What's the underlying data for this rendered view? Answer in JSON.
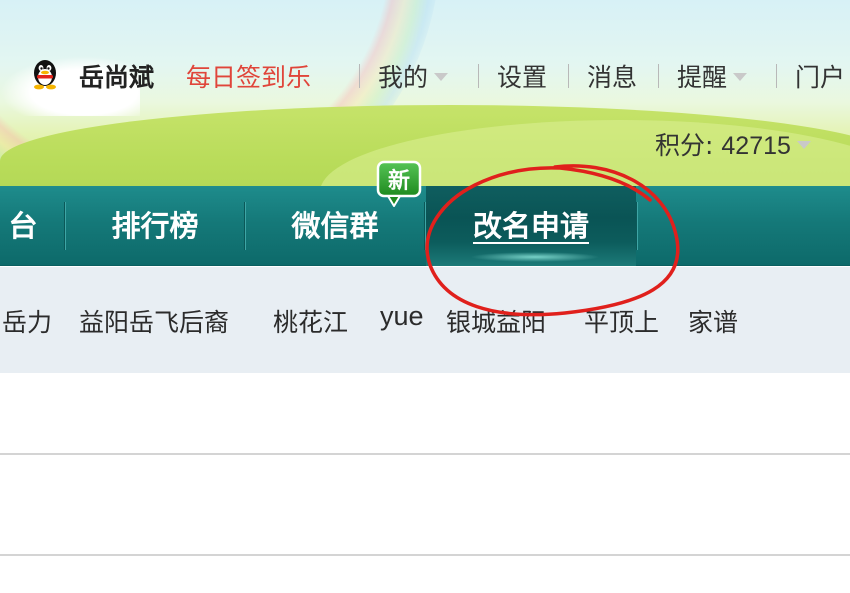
{
  "header": {
    "username": "岳尚斌",
    "checkin_label": "每日签到乐",
    "topnav": {
      "mine_label": "我的",
      "settings_label": "设置",
      "messages_label": "消息",
      "reminders_label": "提醒",
      "portal_label": "门户"
    },
    "points_label": "积分:",
    "points_value": "42715"
  },
  "main_nav": {
    "tabs": [
      {
        "label": "台"
      },
      {
        "label": "排行榜"
      },
      {
        "label": "微信群"
      },
      {
        "label": "改名申请",
        "active": true
      }
    ],
    "new_badge": "新"
  },
  "sub_nav": {
    "links": [
      {
        "label": "岳力"
      },
      {
        "label": "益阳岳飞后裔"
      },
      {
        "label": "桃花江"
      },
      {
        "label": "yue"
      },
      {
        "label": "银城益阳"
      },
      {
        "label": "平顶上"
      },
      {
        "label": "家谱"
      }
    ]
  },
  "colors": {
    "nav_teal": "#157979",
    "checkin_red": "#e0453a",
    "annotation_red": "#e0201c",
    "badge_green": "#2e9a2e"
  },
  "icons": {
    "avatar": "qq-penguin-icon",
    "dropdown": "caret-down-icon",
    "new_badge": "new-badge-icon"
  }
}
